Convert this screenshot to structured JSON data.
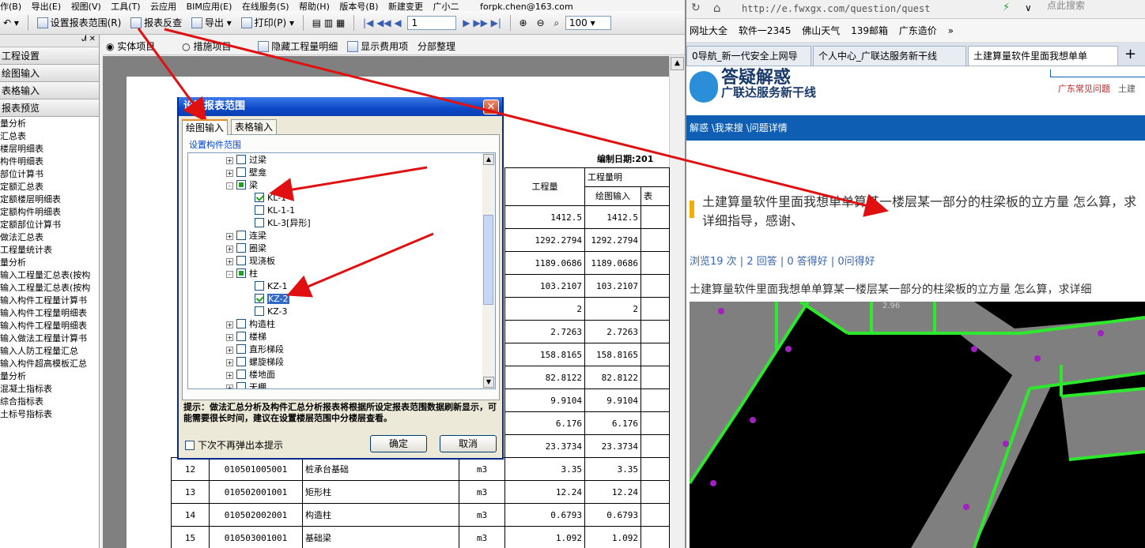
{
  "left_app": {
    "menu": [
      "作(B)",
      "导出(E)",
      "视图(V)",
      "工具(T)",
      "云应用",
      "BIM应用(E)",
      "在线服务(S)",
      "帮助(H)",
      "版本号(B)",
      "新建变更",
      "广小二"
    ],
    "user_email": "forpk.chen@163.com",
    "toolbar": {
      "set_range": "设置报表范围(R)",
      "report_check": "报表反查",
      "export": "导出",
      "print": "打印(P)",
      "page_number": "1",
      "zoom": "100"
    },
    "toolbar2": {
      "entity_items": "实体项目",
      "measure_items": "措施项目",
      "hide_detail": "隐藏工程量明细",
      "show_cost": "显示费用项",
      "section_sort": "分部整理"
    },
    "sidebar": {
      "pin": "ᗂ ✕",
      "sections": [
        "工程设置",
        "绘图输入",
        "表格输入",
        "报表预览"
      ],
      "items": [
        "量分析",
        "汇总表",
        "楼层明细表",
        "构件明细表",
        "部位计算书",
        "定额汇总表",
        "定额楼层明细表",
        "定额构件明细表",
        "定额部位计算书",
        "做法汇总表",
        "工程量统计表",
        "量分析",
        "输入工程量汇总表(按构",
        "输入工程量汇总表(按构",
        "输入构件工程量计算书",
        "输入构件工程量明细表",
        "输入构件工程量明细表",
        "输入做法工程量计算书",
        "输入人防工程量汇总",
        "输入构件超高模板汇总",
        "量分析",
        "混凝土指标表",
        "综合指标表",
        "土标号指标表"
      ]
    },
    "report": {
      "date_label": "编制日期:201",
      "col_qty": "工程量",
      "col_qty_detail": "工程量明",
      "col_draw": "绘图输入",
      "col_table": "表",
      "rows": [
        {
          "no": "",
          "code": "",
          "name": "",
          "unit": "",
          "qty": "1412.5",
          "draw": "1412.5"
        },
        {
          "no": "",
          "code": "",
          "name": "",
          "unit": "",
          "qty": "1292.2794",
          "draw": "1292.2794"
        },
        {
          "no": "",
          "code": "",
          "name": "",
          "unit": "",
          "qty": "1189.0686",
          "draw": "1189.0686"
        },
        {
          "no": "",
          "code": "",
          "name": "",
          "unit": "",
          "qty": "103.2107",
          "draw": "103.2107"
        },
        {
          "no": "",
          "code": "",
          "name": "",
          "unit": "",
          "qty": "2",
          "draw": "2"
        },
        {
          "no": "",
          "code": "",
          "name": "",
          "unit": "",
          "qty": "2.7263",
          "draw": "2.7263"
        },
        {
          "no": "",
          "code": "",
          "name": "",
          "unit": "",
          "qty": "158.8165",
          "draw": "158.8165"
        },
        {
          "no": "",
          "code": "",
          "name": "",
          "unit": "",
          "qty": "82.8122",
          "draw": "82.8122"
        },
        {
          "no": "",
          "code": "",
          "name": "",
          "unit": "",
          "qty": "9.9104",
          "draw": "9.9104"
        },
        {
          "no": "",
          "code": "",
          "name": "",
          "unit": "",
          "qty": "6.176",
          "draw": "6.176"
        },
        {
          "no": "",
          "code": "",
          "name": "",
          "unit": "",
          "qty": "23.3734",
          "draw": "23.3734"
        },
        {
          "no": "12",
          "code": "010501005001",
          "name": "桩承台基础",
          "unit": "m3",
          "qty": "3.35",
          "draw": "3.35"
        },
        {
          "no": "13",
          "code": "010502001001",
          "name": "矩形柱",
          "unit": "m3",
          "qty": "12.24",
          "draw": "12.24"
        },
        {
          "no": "14",
          "code": "010502002001",
          "name": "构造柱",
          "unit": "m3",
          "qty": "0.6793",
          "draw": "0.6793"
        },
        {
          "no": "15",
          "code": "010503001001",
          "name": "基础梁",
          "unit": "m3",
          "qty": "1.092",
          "draw": "1.092"
        }
      ]
    },
    "dialog": {
      "title": "设置报表范围",
      "close": "✕",
      "tab_draw": "绘图输入",
      "tab_table": "表格输入",
      "group_label": "设置构件范围",
      "tree": [
        {
          "label": "过梁",
          "level": 0,
          "exp": "+",
          "state": "off"
        },
        {
          "label": "壁龛",
          "level": 0,
          "exp": "+",
          "state": "off"
        },
        {
          "label": "梁",
          "level": 0,
          "exp": "-",
          "state": "part"
        },
        {
          "label": "KL-1",
          "level": 1,
          "exp": "",
          "state": "on"
        },
        {
          "label": "KL-1-1",
          "level": 1,
          "exp": "",
          "state": "off"
        },
        {
          "label": "KL-3[异形]",
          "level": 1,
          "exp": "",
          "state": "off"
        },
        {
          "label": "连梁",
          "level": 0,
          "exp": "+",
          "state": "off"
        },
        {
          "label": "圈梁",
          "level": 0,
          "exp": "+",
          "state": "off"
        },
        {
          "label": "现浇板",
          "level": 0,
          "exp": "+",
          "state": "off"
        },
        {
          "label": "柱",
          "level": 0,
          "exp": "-",
          "state": "part"
        },
        {
          "label": "KZ-1",
          "level": 1,
          "exp": "",
          "state": "off"
        },
        {
          "label": "KZ-2",
          "level": 1,
          "exp": "",
          "state": "on"
        },
        {
          "label": "KZ-3",
          "level": 1,
          "exp": "",
          "state": "off"
        },
        {
          "label": "构造柱",
          "level": 0,
          "exp": "+",
          "state": "off"
        },
        {
          "label": "楼梯",
          "level": 0,
          "exp": "+",
          "state": "off"
        },
        {
          "label": "直形梯段",
          "level": 0,
          "exp": "+",
          "state": "off"
        },
        {
          "label": "螺旋梯段",
          "level": 0,
          "exp": "+",
          "state": "off"
        },
        {
          "label": "楼地面",
          "level": 0,
          "exp": "+",
          "state": "off"
        },
        {
          "label": "天棚",
          "level": 0,
          "exp": "+",
          "state": "off"
        }
      ],
      "tip": "提示：做法汇总分析及构件汇总分析报表将根据所设定报表范围数据刷新显示，可能需要很长时间，建议在设置楼层范围中分楼层查看。",
      "dont_show": "下次不再弹出本提示",
      "ok": "确定",
      "cancel": "取消"
    }
  },
  "browser": {
    "url": "http://e.fwxgx.com/question/quest",
    "search_placeholder": "点此搜索",
    "bookmarks": [
      "网址大全",
      "软件一2345",
      "佛山天气",
      "139邮箱",
      "广东造价"
    ],
    "tabs": [
      "0导航_新一代安全上网导",
      "个人中心_广联达服务新干线",
      "土建算量软件里面我想单单"
    ],
    "logo_text": "答疑解惑",
    "logo_sub": "广联达服务新干线",
    "top_links": [
      "广东常见问题",
      "土建"
    ],
    "breadcrumb": "解惑 \\我来搜 \\问题详情",
    "question_title": "土建算量软件里面我想单单算某一楼层某一部分的柱梁板的立方量 怎么算，求详细指导，感谢、",
    "stats": "浏览19 次 | 2 回答 | 0 答得好 | 0问得好",
    "question_body": "土建算量软件里面我想单单算某一楼层某一部分的柱梁板的立方量 怎么算，求详细",
    "cad_label": "2.96"
  },
  "colors": {
    "dialog_title": "#0a48c8",
    "arrow": "#e01010",
    "cad_green": "#2ee82e",
    "cad_slab": "#7f7f7f",
    "browser_blue": "#0e5fb4"
  }
}
